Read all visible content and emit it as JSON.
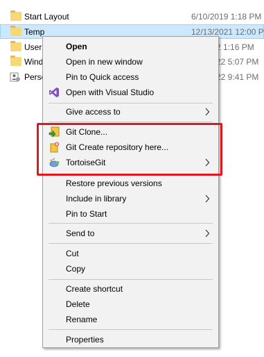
{
  "files": [
    {
      "name": "Start Layout",
      "date": "6/10/2019 1:18 PM",
      "icon": "folder-icon"
    },
    {
      "name": "Temp",
      "date": "12/13/2021 12:00 P",
      "icon": "folder-icon",
      "selected": true
    },
    {
      "name": "Users",
      "date": "2 1:16 PM",
      "icon": "folder-icon"
    },
    {
      "name": "Wind",
      "date": "22 5:07 PM",
      "icon": "folder-icon"
    },
    {
      "name": "Perso",
      "date": "22 9:41 PM",
      "icon": "person-settings-icon"
    }
  ],
  "menu": {
    "items": [
      {
        "label": "Open"
      },
      {
        "label": "Open in new window"
      },
      {
        "label": "Pin to Quick access"
      },
      {
        "label": "Open with Visual Studio",
        "icon": "visual-studio-icon"
      },
      {
        "label": "Give access to"
      },
      {
        "label": "Git Clone...",
        "icon": "git-clone-icon"
      },
      {
        "label": "Git Create repository here...",
        "icon": "git-create-repo-icon"
      },
      {
        "label": "TortoiseGit",
        "icon": "tortoisegit-icon"
      },
      {
        "label": "Restore previous versions"
      },
      {
        "label": "Include in library"
      },
      {
        "label": "Pin to Start"
      },
      {
        "label": "Send to"
      },
      {
        "label": "Cut"
      },
      {
        "label": "Copy"
      },
      {
        "label": "Create shortcut"
      },
      {
        "label": "Delete"
      },
      {
        "label": "Rename"
      },
      {
        "label": "Properties"
      }
    ]
  },
  "colors": {
    "highlight_border": "#e0171f",
    "selection_bg": "#cce8ff",
    "menu_bg": "#f2f2f2"
  }
}
